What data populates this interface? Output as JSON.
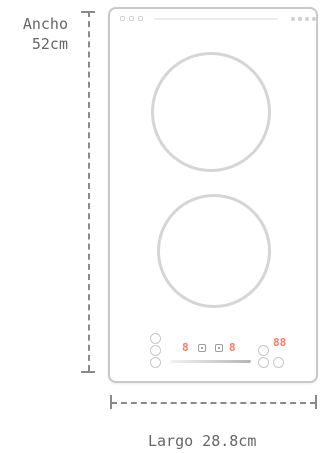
{
  "dimensions": {
    "height_label_line1": "Ancho",
    "height_label_line2": "52cm",
    "width_label": "Largo 28.8cm"
  },
  "displays": {
    "left_zone_level": "8",
    "center_zone_level": "8",
    "timer_value": "88"
  },
  "colors": {
    "display_accent": "#ff7a64",
    "outline_gray": "#c9c9c9",
    "dimension_gray": "#8a8a8a"
  },
  "icons": [
    "dashed-vertical-dimension-line",
    "dashed-horizontal-dimension-line",
    "burner-ring-icon",
    "touch-button-icon",
    "timer-display-icon",
    "power-slider-icon"
  ]
}
